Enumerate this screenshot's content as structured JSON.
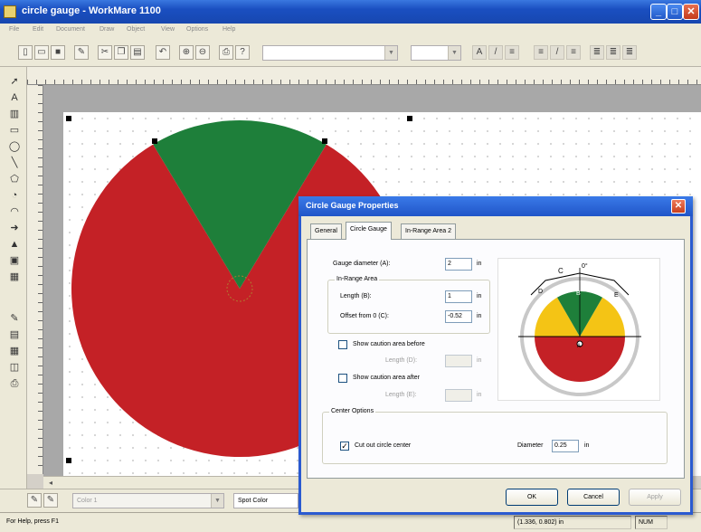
{
  "app": {
    "title": "circle gauge - WorkMare 1100",
    "menu": [
      "File",
      "Edit",
      "Document",
      "Draw",
      "Object",
      "View",
      "Options",
      "Help"
    ]
  },
  "toolbar": {
    "font_combo": "",
    "size_combo": ""
  },
  "bottom": {
    "color_combo": "Color 1",
    "spot_color_combo": "Spot Color"
  },
  "status": {
    "help": "For Help, press F1",
    "coords": "(1.336, 0.802) in",
    "mode": "NUM"
  },
  "gauge": {
    "colors": {
      "red": "#c42126",
      "green": "#1e7f3a",
      "yellow": "#f4c415"
    }
  },
  "dialog": {
    "title": "Circle Gauge Properties",
    "tabs": [
      "General",
      "Circle Gauge",
      "In-Range Area 2"
    ],
    "active_tab": "Circle Gauge",
    "gauge_diameter_label": "Gauge diameter (A):",
    "gauge_diameter_value": "2",
    "unit": "in",
    "in_range_group": "In-Range Area",
    "length_b_label": "Length (B):",
    "length_b_value": "1",
    "offset_label": "Offset from 0 (C):",
    "offset_value": "-0.52",
    "caution_before_label": "Show caution area before",
    "caution_before_length_label": "Length (D):",
    "caution_before_length_value": "",
    "caution_after_label": "Show caution area after",
    "caution_after_length_label": "Length (E):",
    "caution_after_length_value": "",
    "center_group": "Center Options",
    "cut_out_label": "Cut out circle center",
    "cut_out_checked": "✓",
    "diameter_label": "Diameter",
    "diameter_value": "0.25",
    "preview_labels": {
      "a": "A",
      "b": "B",
      "c": "C",
      "d": "D",
      "e": "E",
      "zero": "0°"
    },
    "buttons": {
      "ok": "OK",
      "cancel": "Cancel",
      "apply": "Apply"
    }
  }
}
